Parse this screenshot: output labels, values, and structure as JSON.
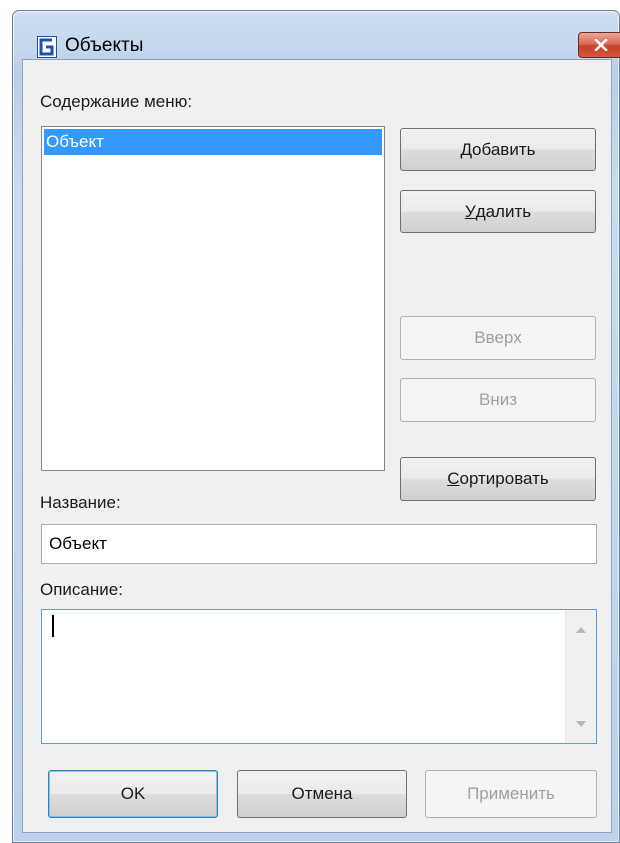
{
  "window": {
    "title": "Объекты",
    "title_icon": "app-logo-icon",
    "close_icon": "close-icon"
  },
  "menu_content": {
    "label": "Содержание меню:",
    "items": [
      "Объект"
    ],
    "selected_index": 0
  },
  "buttons": {
    "add": {
      "hotkey": "Д",
      "rest": "обавить"
    },
    "delete": {
      "hotkey": "У",
      "rest": "далить"
    },
    "up": "Вверх",
    "down": "Вниз",
    "sort": {
      "hotkey": "С",
      "rest": "ортировать"
    }
  },
  "name_field": {
    "label": "Название:",
    "value": "Объект"
  },
  "description_field": {
    "label": "Описание:",
    "value": ""
  },
  "footer": {
    "ok": "OK",
    "cancel": "Отмена",
    "apply": "Применить"
  },
  "colors": {
    "selection": "#3399ff",
    "close_button": "#c7412b",
    "focus_border": "#569de5"
  }
}
